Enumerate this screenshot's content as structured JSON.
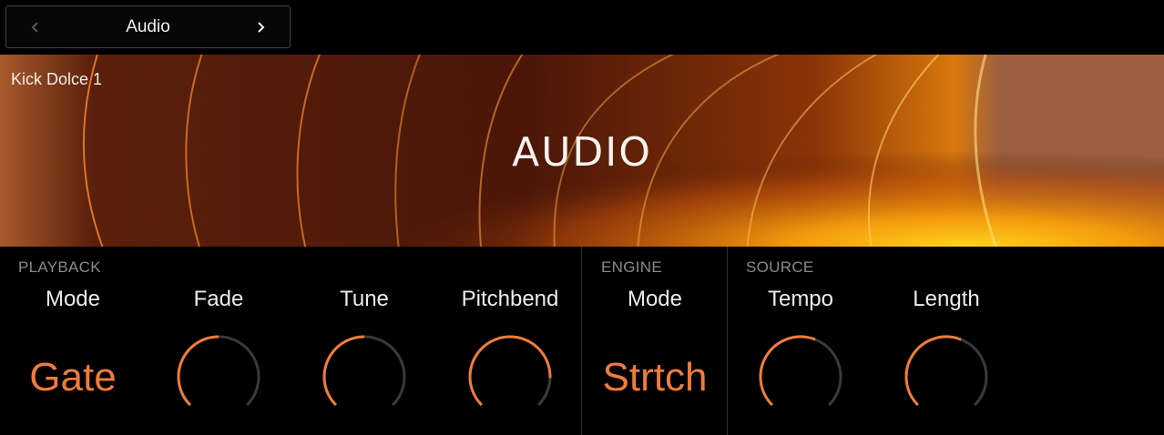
{
  "nav": {
    "title": "Audio",
    "prev_icon": "chevron-left",
    "next_icon": "chevron-right"
  },
  "banner": {
    "preset_name": "Kick Dolce 1",
    "title": "AUDIO"
  },
  "sections": {
    "playback": {
      "label": "PLAYBACK"
    },
    "engine": {
      "label": "ENGINE"
    },
    "source": {
      "label": "SOURCE"
    }
  },
  "params": {
    "playback_mode": {
      "name": "Mode",
      "value": "Gate"
    },
    "fade": {
      "name": "Fade",
      "level": 0.5
    },
    "tune": {
      "name": "Tune",
      "level": 0.5
    },
    "pitchbend": {
      "name": "Pitchbend",
      "level": 0.84
    },
    "engine_mode": {
      "name": "Mode",
      "value": "Strtch"
    },
    "tempo": {
      "name": "Tempo",
      "level": 0.58
    },
    "length": {
      "name": "Length",
      "level": 0.58
    }
  },
  "colors": {
    "accent": "#f07b3a",
    "track": "#3a3a3a",
    "label": "#8a8a8a"
  }
}
